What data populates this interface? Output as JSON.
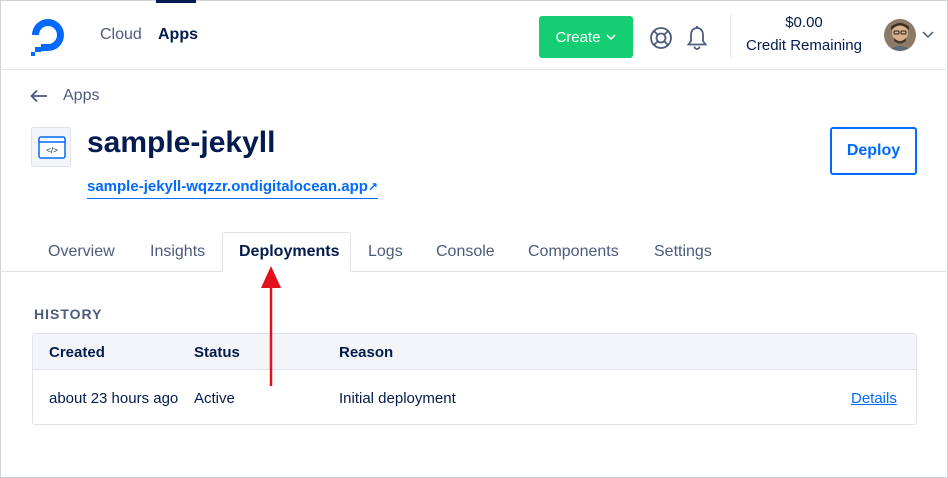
{
  "nav": {
    "cloud": "Cloud",
    "apps": "Apps",
    "create_label": "Create",
    "credit_amount": "$0.00",
    "credit_label": "Credit Remaining",
    "icons": [
      "digitalocean-logo",
      "chevron-down-icon",
      "help-lifebuoy-icon",
      "bell-icon",
      "avatar",
      "chevron-down-icon"
    ],
    "colors": {
      "create": "#15cd72",
      "brand": "#0069ff",
      "text": "#031b4e"
    }
  },
  "breadcrumb": {
    "label": "Apps"
  },
  "app": {
    "title": "sample-jekyll",
    "url": "sample-jekyll-wqzzr.ondigitalocean.app",
    "url_icon": "↗",
    "deploy_label": "Deploy"
  },
  "tabs": [
    {
      "label": "Overview"
    },
    {
      "label": "Insights"
    },
    {
      "label": "Deployments",
      "active": true
    },
    {
      "label": "Logs"
    },
    {
      "label": "Console"
    },
    {
      "label": "Components"
    },
    {
      "label": "Settings"
    }
  ],
  "history": {
    "heading": "HISTORY",
    "columns": [
      "Created",
      "Status",
      "Reason"
    ],
    "rows": [
      {
        "created": "about 23 hours ago",
        "status": "Active",
        "reason": "Initial deployment",
        "action": "Details"
      }
    ]
  },
  "annotation": {
    "color": "#e3111b",
    "points_to": "Deployments tab"
  }
}
